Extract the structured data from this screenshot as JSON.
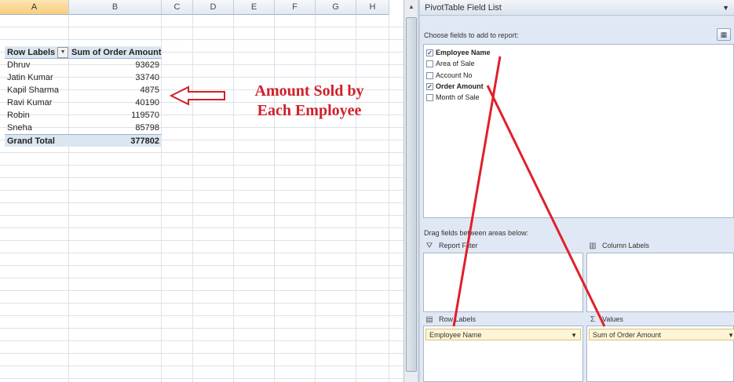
{
  "sheet": {
    "columns": [
      "A",
      "B",
      "C",
      "D",
      "E",
      "F",
      "G",
      "H"
    ],
    "header_row": {
      "label": "Row Labels",
      "value": "Sum of Order Amount"
    },
    "rows": [
      {
        "label": "Dhruv",
        "value": "93629"
      },
      {
        "label": "Jatin Kumar",
        "value": "33740"
      },
      {
        "label": "Kapil Sharma",
        "value": "4875"
      },
      {
        "label": "Ravi Kumar",
        "value": "40190"
      },
      {
        "label": "Robin",
        "value": "119570"
      },
      {
        "label": "Sneha",
        "value": "85798"
      }
    ],
    "total_row": {
      "label": "Grand Total",
      "value": "377802"
    }
  },
  "annotation": {
    "line1": "Amount Sold  by",
    "line2": "Each Employee",
    "color": "#d0202a"
  },
  "pivot": {
    "title": "PivotTable Field List",
    "choose_label": "Choose fields to add to report:",
    "fields": [
      {
        "label": "Employee Name",
        "checked": true
      },
      {
        "label": "Area of Sale",
        "checked": false
      },
      {
        "label": "Account No",
        "checked": false
      },
      {
        "label": "Order Amount",
        "checked": true
      },
      {
        "label": "Month of Sale",
        "checked": false
      }
    ],
    "drag_label": "Drag fields between areas below:",
    "areas": {
      "report_filter": "Report Filter",
      "column_labels": "Column Labels",
      "row_labels": "Row Labels",
      "values": "Values"
    },
    "row_field": "Employee Name",
    "value_field": "Sum of Order Amount"
  }
}
